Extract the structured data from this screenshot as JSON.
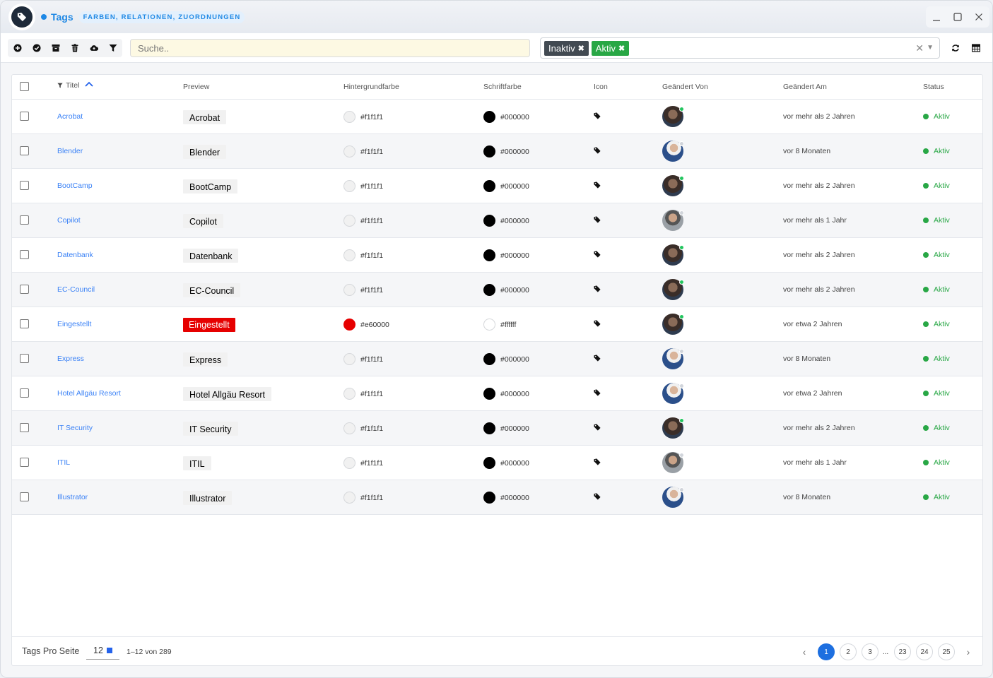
{
  "window": {
    "title": "Tags",
    "subtitle_badge": "FARBEN, RELATIONEN, ZUORDNUNGEN",
    "controls": {
      "minimize": "—",
      "maximize": "☐",
      "close": "✕"
    }
  },
  "toolbar": {
    "icons": [
      "add-icon",
      "check-icon",
      "archive-icon",
      "trash-icon",
      "cloud-upload-icon",
      "filter-icon"
    ],
    "search_placeholder": "Suche..",
    "filter_chips": [
      {
        "label": "Inaktiv",
        "color": "#424a52"
      },
      {
        "label": "Aktiv",
        "color": "#28a745"
      }
    ]
  },
  "table": {
    "columns": {
      "titel": "Titel",
      "preview": "Preview",
      "hintergrundfarbe": "Hintergrundfarbe",
      "schriftfarbe": "Schriftfarbe",
      "icon": "Icon",
      "geaendert_von": "Geändert Von",
      "geaendert_am": "Geändert Am",
      "status": "Status"
    },
    "sort": {
      "column": "Titel",
      "direction": "ascending"
    },
    "rows": [
      {
        "title": "Acrobat",
        "bg": "#f1f1f1",
        "fg": "#000000",
        "user": "a",
        "changed": "vor mehr als 2 Jahren",
        "status": "Aktiv"
      },
      {
        "title": "Blender",
        "bg": "#f1f1f1",
        "fg": "#000000",
        "user": "b",
        "changed": "vor 8 Monaten",
        "status": "Aktiv"
      },
      {
        "title": "BootCamp",
        "bg": "#f1f1f1",
        "fg": "#000000",
        "user": "a",
        "changed": "vor mehr als 2 Jahren",
        "status": "Aktiv"
      },
      {
        "title": "Copilot",
        "bg": "#f1f1f1",
        "fg": "#000000",
        "user": "c",
        "changed": "vor mehr als 1 Jahr",
        "status": "Aktiv"
      },
      {
        "title": "Datenbank",
        "bg": "#f1f1f1",
        "fg": "#000000",
        "user": "a",
        "changed": "vor mehr als 2 Jahren",
        "status": "Aktiv"
      },
      {
        "title": "EC-Council",
        "bg": "#f1f1f1",
        "fg": "#000000",
        "user": "a",
        "changed": "vor mehr als 2 Jahren",
        "status": "Aktiv"
      },
      {
        "title": "Eingestellt",
        "bg": "#e60000",
        "fg": "#ffffff",
        "user": "a",
        "changed": "vor etwa 2 Jahren",
        "status": "Aktiv"
      },
      {
        "title": "Express",
        "bg": "#f1f1f1",
        "fg": "#000000",
        "user": "b",
        "changed": "vor 8 Monaten",
        "status": "Aktiv"
      },
      {
        "title": "Hotel Allgäu Resort",
        "bg": "#f1f1f1",
        "fg": "#000000",
        "user": "b",
        "changed": "vor etwa 2 Jahren",
        "status": "Aktiv"
      },
      {
        "title": "IT Security",
        "bg": "#f1f1f1",
        "fg": "#000000",
        "user": "a",
        "changed": "vor mehr als 2 Jahren",
        "status": "Aktiv"
      },
      {
        "title": "ITIL",
        "bg": "#f1f1f1",
        "fg": "#000000",
        "user": "c",
        "changed": "vor mehr als 1 Jahr",
        "status": "Aktiv"
      },
      {
        "title": "Illustrator",
        "bg": "#f1f1f1",
        "fg": "#000000",
        "user": "b",
        "changed": "vor 8 Monaten",
        "status": "Aktiv"
      }
    ]
  },
  "footer": {
    "per_page_label": "Tags Pro Seite",
    "per_page_value": "12",
    "range": "1–12 von 289",
    "pages": [
      "1",
      "2",
      "3",
      "...",
      "23",
      "24",
      "25"
    ],
    "current_page": "1",
    "prev": "‹",
    "next": "›"
  },
  "colors": {
    "accent": "#1e88e5",
    "link": "#3b82f6",
    "active": "#28a745",
    "online_dot": "#22c55e",
    "offline_dot": "#d1d5db"
  }
}
